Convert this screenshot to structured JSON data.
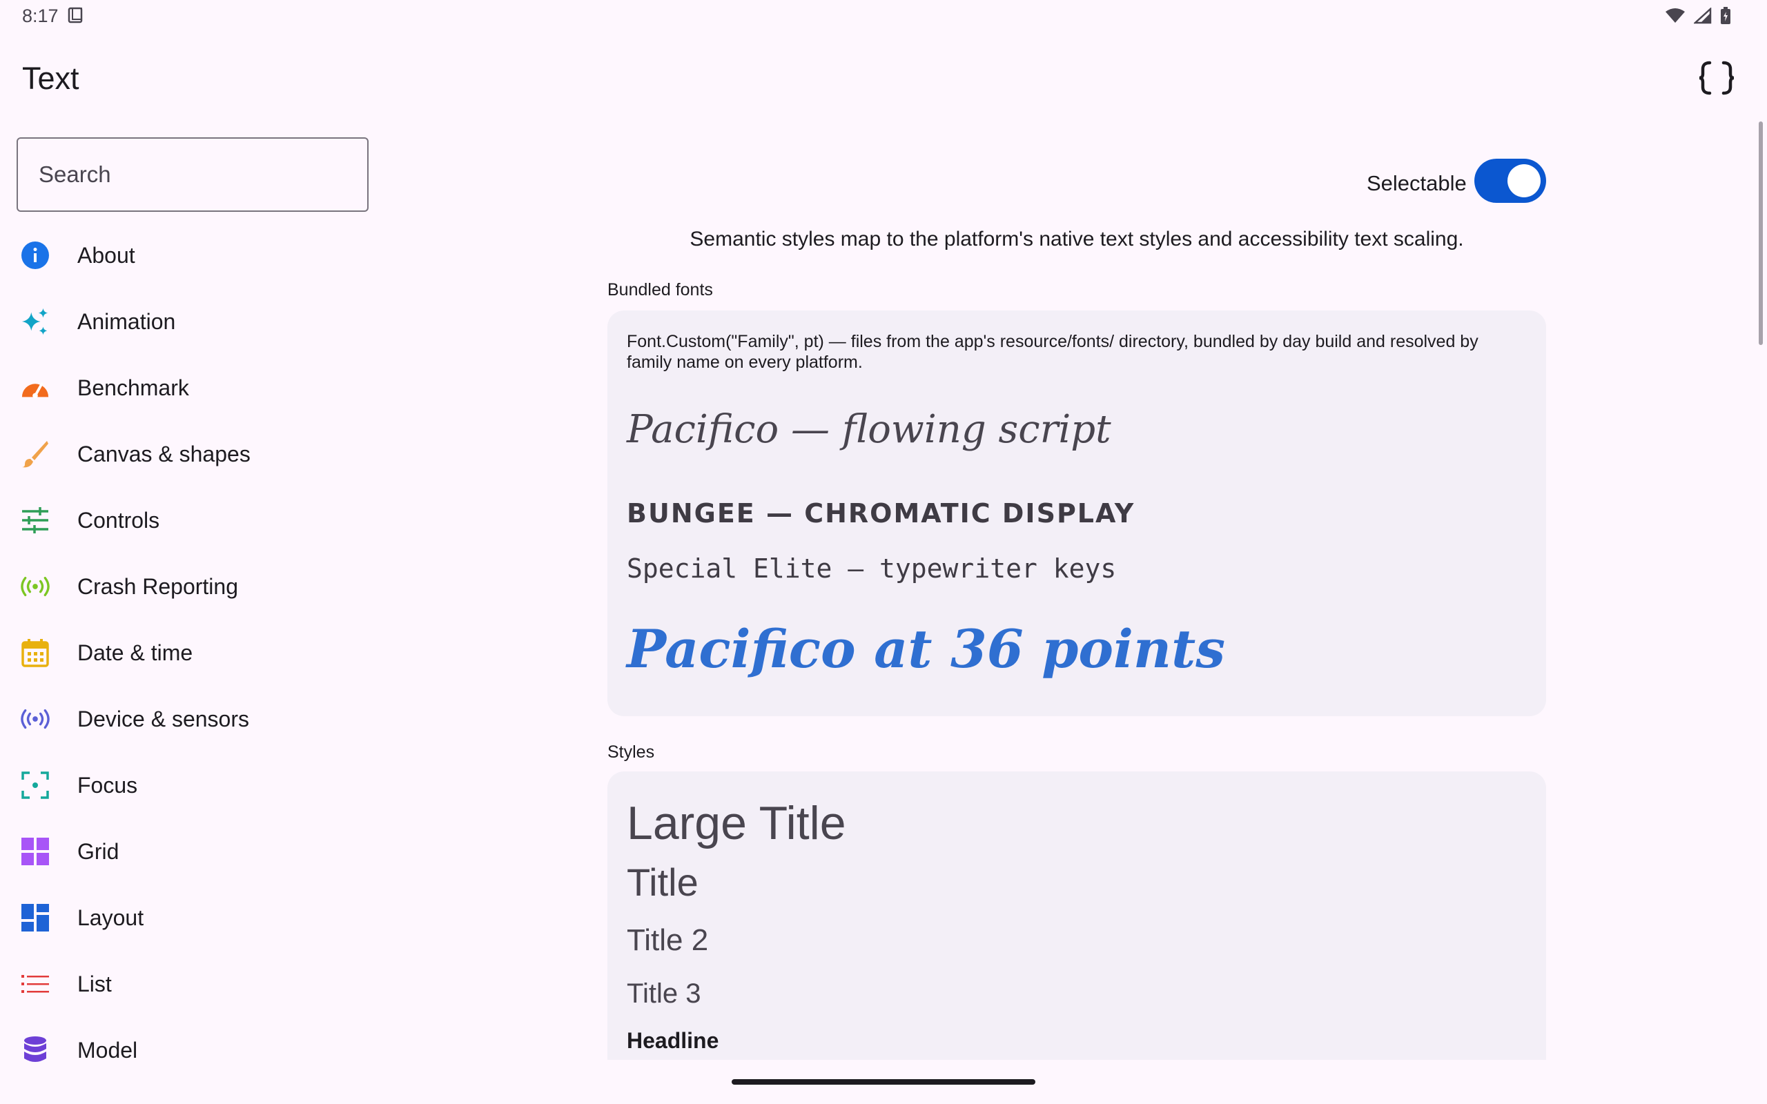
{
  "status": {
    "time": "8:17"
  },
  "app": {
    "title": "Text"
  },
  "search": {
    "placeholder": "Search"
  },
  "nav": [
    {
      "label": "About",
      "icon": "info-icon",
      "color": "#1a73e8"
    },
    {
      "label": "Animation",
      "icon": "sparkles-icon",
      "color": "#12a4c7"
    },
    {
      "label": "Benchmark",
      "icon": "speedometer-icon",
      "color": "#f26b1d"
    },
    {
      "label": "Canvas & shapes",
      "icon": "brush-icon",
      "color": "#f0a24a"
    },
    {
      "label": "Controls",
      "icon": "sliders-icon",
      "color": "#2e9e57"
    },
    {
      "label": "Crash Reporting",
      "icon": "broadcast-icon",
      "color": "#7cc623"
    },
    {
      "label": "Date & time",
      "icon": "calendar-icon",
      "color": "#e8b10e"
    },
    {
      "label": "Device & sensors",
      "icon": "sensor-icon",
      "color": "#5b5fd6"
    },
    {
      "label": "Focus",
      "icon": "focus-icon",
      "color": "#14a89b"
    },
    {
      "label": "Grid",
      "icon": "grid-icon",
      "color": "#a855f7"
    },
    {
      "label": "Layout",
      "icon": "layout-icon",
      "color": "#1e63d6"
    },
    {
      "label": "List",
      "icon": "list-icon",
      "color": "#e23b3b"
    },
    {
      "label": "Model",
      "icon": "database-icon",
      "color": "#6d3fd6"
    }
  ],
  "main": {
    "selectable_label": "Selectable",
    "selectable_on": true,
    "intro": "Semantic styles map to the platform's native text styles and accessibility text scaling.",
    "bundled_fonts_label": "Bundled fonts",
    "bundled_desc": "Font.Custom(\"Family\", pt) — files from the app's resource/fonts/ directory, bundled by day build and resolved by family name on every platform.",
    "font_samples": [
      "Pacifico — flowing script",
      "BUNGEE — CHROMATIC DISPLAY",
      "Special Elite — typewriter keys",
      "Pacifico at 36 points"
    ],
    "styles_label": "Styles",
    "styles": [
      "Large Title",
      "Title",
      "Title 2",
      "Title 3",
      "Headline"
    ]
  },
  "colors": {
    "accent": "#0b57d0",
    "card": "#f3eff7",
    "background": "#fef7fe"
  }
}
